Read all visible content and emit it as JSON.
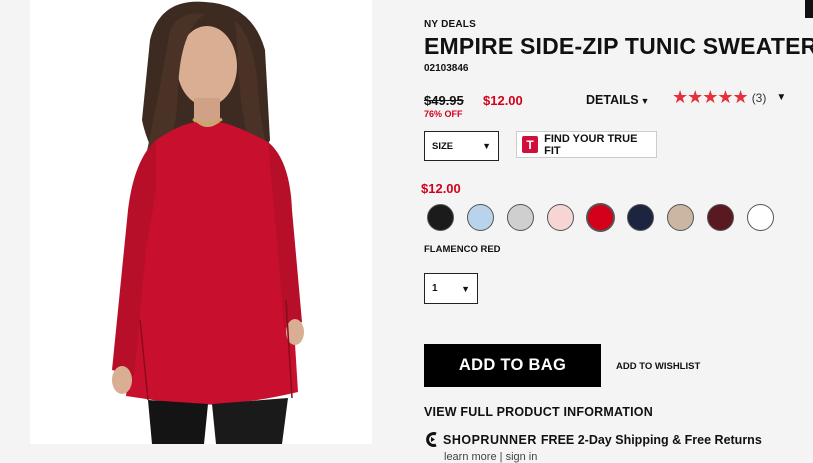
{
  "thumbnails": [
    {
      "name": "beige-front-view"
    },
    {
      "name": "beige-side-view"
    },
    {
      "name": "red-full-view"
    }
  ],
  "product": {
    "eyebrow": "NY DEALS",
    "title": "EMPIRE SIDE-ZIP TUNIC SWEATER",
    "sku": "02103846",
    "price_original": "$49.95",
    "price_sale": "$12.00",
    "discount": "76% OFF",
    "details_label": "DETAILS",
    "rating_count": "(3)",
    "rating_stars": 5
  },
  "size": {
    "label": "SIZE"
  },
  "truefit": {
    "logo": "T",
    "label": "FIND YOUR TRUE FIT"
  },
  "current_price": "$12.00",
  "swatches": [
    {
      "name": "black",
      "color": "#1b1b1b"
    },
    {
      "name": "light-blue",
      "color": "#b9d3ec"
    },
    {
      "name": "light-gray",
      "color": "#cfcfcf"
    },
    {
      "name": "blush-pink",
      "color": "#f7d5d5"
    },
    {
      "name": "flamenco-red",
      "color": "#d4001a",
      "selected": true
    },
    {
      "name": "navy",
      "color": "#1c2440"
    },
    {
      "name": "taupe",
      "color": "#cbb5a3"
    },
    {
      "name": "burgundy",
      "color": "#5a1820"
    },
    {
      "name": "white",
      "color": "#ffffff"
    }
  ],
  "selected_color": "FLAMENCO RED",
  "quantity": {
    "value": "1"
  },
  "actions": {
    "add_to_bag": "ADD TO BAG",
    "wishlist": "ADD TO WISHLIST",
    "view_full": "VIEW FULL PRODUCT INFORMATION"
  },
  "shoprunner": {
    "name": "SHOPRUNNER",
    "text": "FREE 2-Day Shipping & Free Returns",
    "learn_more": "learn more",
    "sep": "|",
    "sign_in": "sign in"
  },
  "colors": {
    "accent_red": "#d4001a",
    "star_red": "#e5313a"
  }
}
